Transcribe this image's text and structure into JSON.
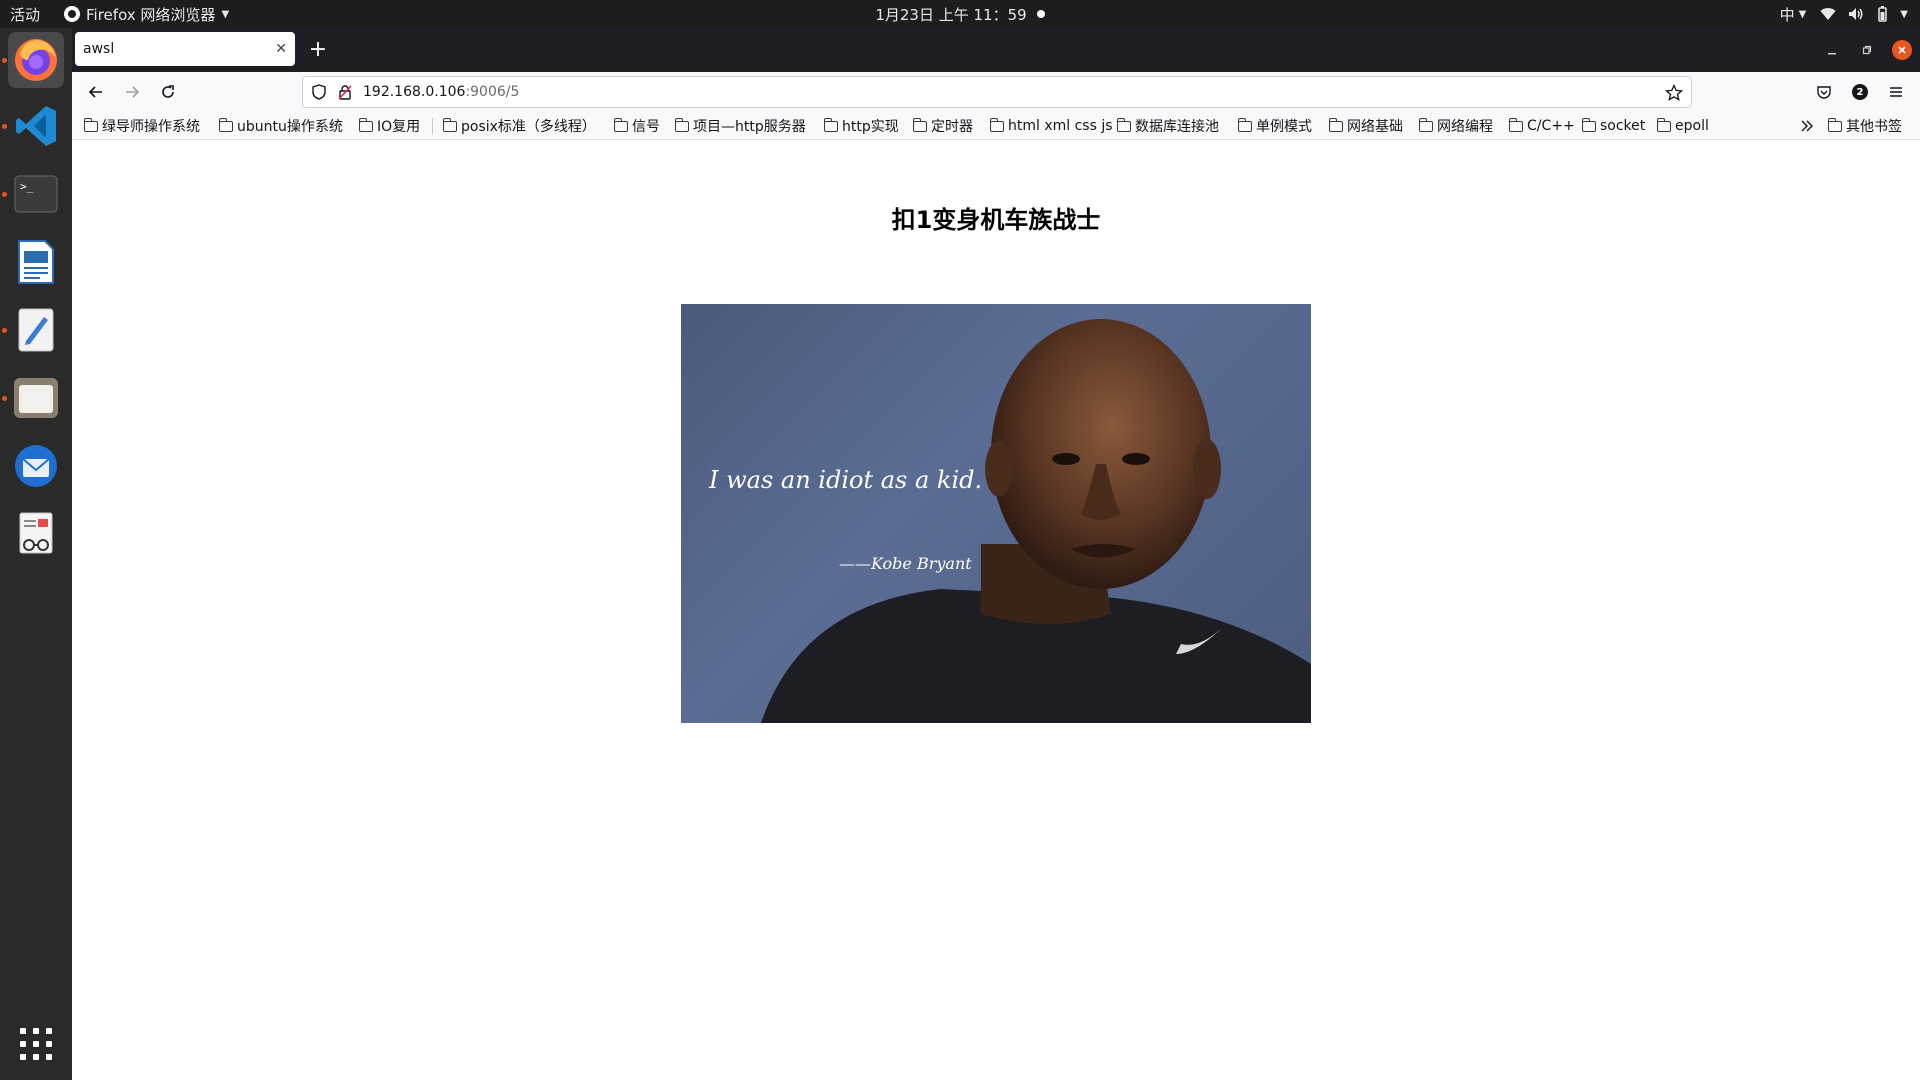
{
  "topbar": {
    "activities": "活动",
    "app_name": "Firefox 网络浏览器",
    "clock": "1月23日 上午 11：59",
    "input_method": "中"
  },
  "dock": {
    "apps": [
      "firefox",
      "vscode",
      "terminal",
      "libreoffice-writer",
      "text-editor",
      "files",
      "thunderbird",
      "document-viewer"
    ]
  },
  "browser": {
    "tab_title": "awsl",
    "url_host": "192.168.0.106",
    "url_path": ":9006/5",
    "account_badge": "2",
    "bookmarks": [
      "绿导师操作系统",
      "ubuntu操作系统",
      "IO复用",
      "posix标准（多线程）",
      "信号",
      "项目—http服务器",
      "http实现",
      "定时器",
      "html xml css js",
      "数据库连接池",
      "单例模式",
      "网络基础",
      "网络编程",
      "C/C++",
      "socket",
      "epoll"
    ],
    "other_bookmarks": "其他书签"
  },
  "page": {
    "heading": "扣1变身机车族战士",
    "image_quote": "I was an idiot as a kid.",
    "image_author": "——Kobe Bryant"
  }
}
